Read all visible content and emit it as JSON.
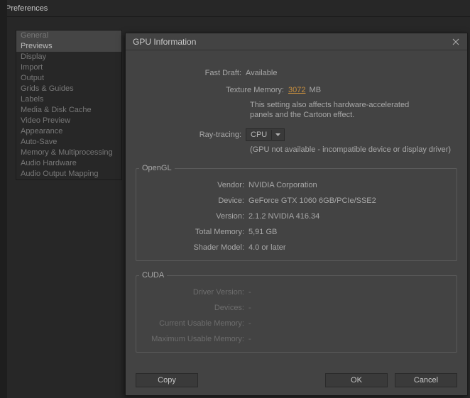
{
  "window": {
    "title": "Preferences"
  },
  "sidebar": {
    "items": [
      "General",
      "Previews",
      "Display",
      "Import",
      "Output",
      "Grids & Guides",
      "Labels",
      "Media & Disk Cache",
      "Video Preview",
      "Appearance",
      "Auto-Save",
      "Memory & Multiprocessing",
      "Audio Hardware",
      "Audio Output Mapping"
    ],
    "selected_index": 1
  },
  "modal": {
    "title": "GPU Information",
    "fast_draft_label": "Fast Draft:",
    "fast_draft_value": "Available",
    "texture_memory_label": "Texture Memory:",
    "texture_memory_value": "3072",
    "texture_memory_unit": "MB",
    "texture_note_line1": "This setting also affects hardware-accelerated",
    "texture_note_line2": "panels and the Cartoon effect.",
    "ray_tracing_label": "Ray-tracing:",
    "ray_tracing_value": "CPU",
    "ray_warning": "(GPU not available - incompatible device or display driver)",
    "opengl": {
      "legend": "OpenGL",
      "vendor_label": "Vendor:",
      "vendor_value": "NVIDIA Corporation",
      "device_label": "Device:",
      "device_value": "GeForce GTX 1060 6GB/PCIe/SSE2",
      "version_label": "Version:",
      "version_value": "2.1.2 NVIDIA 416.34",
      "total_memory_label": "Total Memory:",
      "total_memory_value": "5,91 GB",
      "shader_model_label": "Shader Model:",
      "shader_model_value": "4.0 or later"
    },
    "cuda": {
      "legend": "CUDA",
      "driver_version_label": "Driver Version:",
      "driver_version_value": "-",
      "devices_label": "Devices:",
      "devices_value": "-",
      "current_usable_label": "Current Usable Memory:",
      "current_usable_value": "-",
      "max_usable_label": "Maximum Usable Memory:",
      "max_usable_value": "-"
    },
    "buttons": {
      "copy": "Copy",
      "ok": "OK",
      "cancel": "Cancel"
    }
  }
}
